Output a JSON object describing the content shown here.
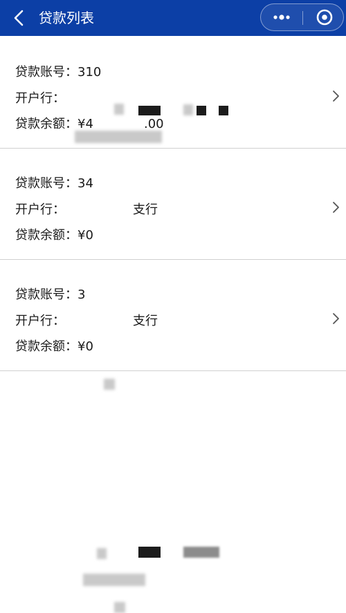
{
  "nav": {
    "title": "贷款列表",
    "back_icon": "chevron-left-icon",
    "more_icon": "more-dots-icon",
    "close_icon": "target-close-icon",
    "background": "#0c3fa6"
  },
  "loans": [
    {
      "account_label": "贷款账号：",
      "account_value": "310",
      "bank_label": "开户行：",
      "bank_value": "",
      "balance_label": "贷款余额：",
      "balance_value": "¥4",
      "balance_tail": ".00"
    },
    {
      "account_label": "贷款账号：",
      "account_value": "34",
      "bank_label": "开户行：",
      "bank_value": "支行",
      "balance_label": "贷款余额：",
      "balance_value": "¥0",
      "balance_tail": ""
    },
    {
      "account_label": "贷款账号：",
      "account_value": "3",
      "bank_label": "开户行：",
      "bank_value": "支行",
      "balance_label": "贷款余额：",
      "balance_value": "¥0",
      "balance_tail": ""
    }
  ]
}
